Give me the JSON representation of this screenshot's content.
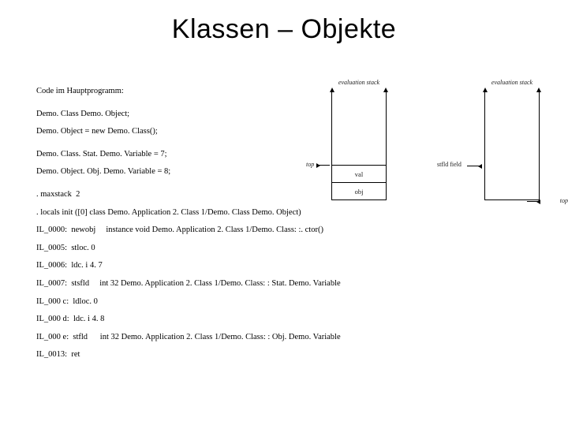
{
  "title": "Klassen – Objekte",
  "code_heading": "Code im Hauptprogramm:",
  "src1": "Demo. Class Demo. Object;",
  "src2": "Demo. Object = new Demo. Class();",
  "src3": "Demo. Class. Stat. Demo. Variable = 7;",
  "src4": "Demo. Object. Obj. Demo. Variable = 8;",
  "il0": ". maxstack  2",
  "il1": ". locals init ([0] class Demo. Application 2. Class 1/Demo. Class Demo. Object)",
  "il2": "IL_0000:  newobj     instance void Demo. Application 2. Class 1/Demo. Class: :. ctor()",
  "il3": "IL_0005:  stloc. 0",
  "il4": "IL_0006:  ldc. i 4. 7",
  "il5": "IL_0007:  stsfld     int 32 Demo. Application 2. Class 1/Demo. Class: : Stat. Demo. Variable",
  "il6": "IL_000 c:  ldloc. 0",
  "il7": "IL_000 d:  ldc. i 4. 8",
  "il8": "IL_000 e:  stfld      int 32 Demo. Application 2. Class 1/Demo. Class: : Obj. Demo. Variable",
  "il9": "IL_0013:  ret",
  "diagram": {
    "es_label": "evaluation stack",
    "top_label": "top",
    "left_stack": {
      "cell_upper": "val",
      "cell_lower": "obj"
    },
    "right_side": "stfld field"
  }
}
